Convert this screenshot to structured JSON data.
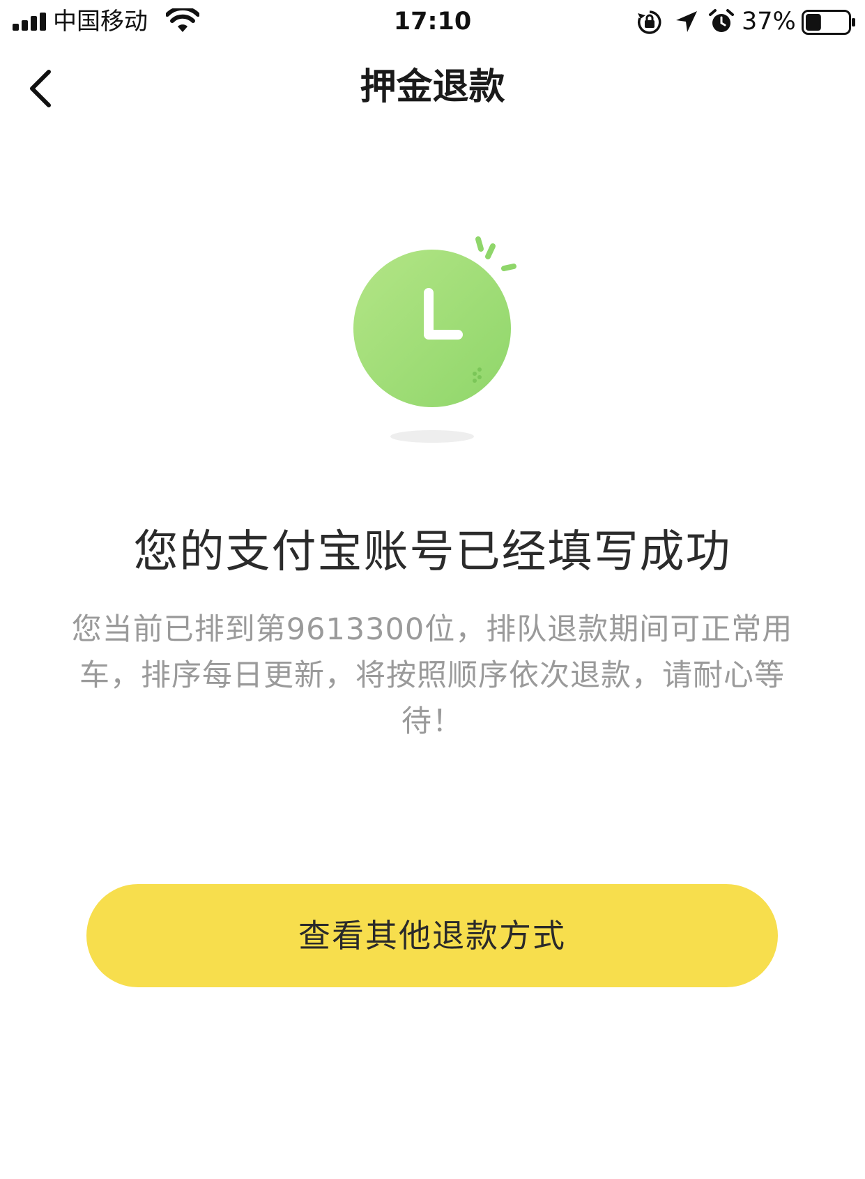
{
  "status_bar": {
    "carrier": "中国移动",
    "time": "17:10",
    "battery_percent": "37%",
    "battery_level": 0.37,
    "icons": [
      "signal-icon",
      "wifi-icon",
      "rotation-lock-icon",
      "location-arrow-icon",
      "alarm-icon",
      "battery-icon"
    ]
  },
  "nav": {
    "title": "押金退款",
    "back_icon": "chevron-left-icon"
  },
  "illustration": {
    "icon": "clock-icon",
    "colors": {
      "clock_face_light": "#b3e586",
      "clock_face_dark": "#8fd66a",
      "shadow": "#eeeeee"
    }
  },
  "main": {
    "headline": "您的支付宝账号已经填写成功",
    "description": "您当前已排到第9613300位，排队退款期间可正常用车，排序每日更新，将按照顺序依次退款，请耐心等待！"
  },
  "action": {
    "button_label": "查看其他退款方式",
    "button_color": "#f7de4d"
  }
}
